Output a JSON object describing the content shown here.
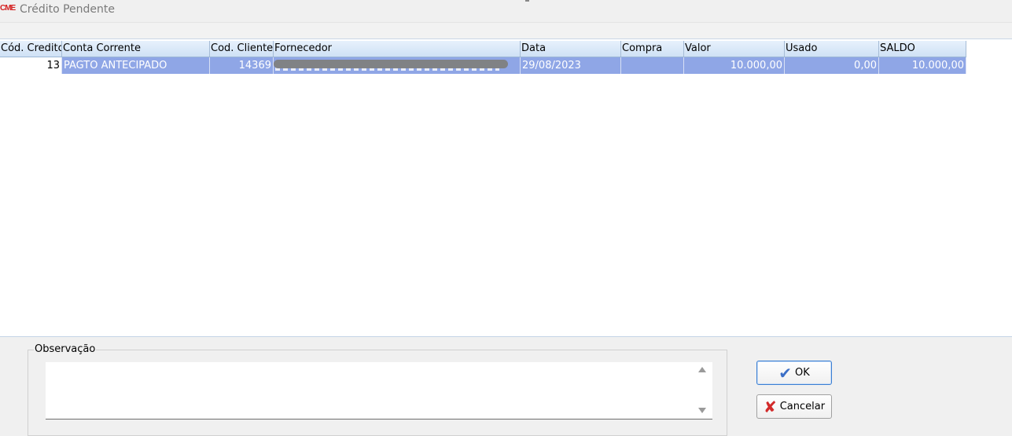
{
  "window": {
    "logo_text": "CME",
    "title": "Crédito Pendente"
  },
  "grid": {
    "columns": [
      "Cód. Credito",
      "Conta Corrente",
      "Cod. Cliente",
      "Fornecedor",
      "Data",
      "Compra",
      "Valor",
      "Usado",
      "SALDO"
    ],
    "rows": [
      {
        "cod_credito": "13",
        "conta_corrente": "PAGTO ANTECIPADO",
        "cod_cliente": "14369",
        "fornecedor": "",
        "data": "29/08/2023",
        "compra": "",
        "valor": "10.000,00",
        "usado": "0,00",
        "saldo": "10.000,00"
      }
    ],
    "selected_row_color": "#8fa6e6"
  },
  "observacao": {
    "label": "Observação",
    "value": ""
  },
  "buttons": {
    "ok_label": "OK",
    "cancel_label": "Cancelar"
  },
  "icons": {
    "app": "cme-logo-icon",
    "ok": "checkmark-icon",
    "cancel": "x-icon",
    "scroll_up": "arrow-up-icon",
    "scroll_down": "arrow-down-icon"
  }
}
